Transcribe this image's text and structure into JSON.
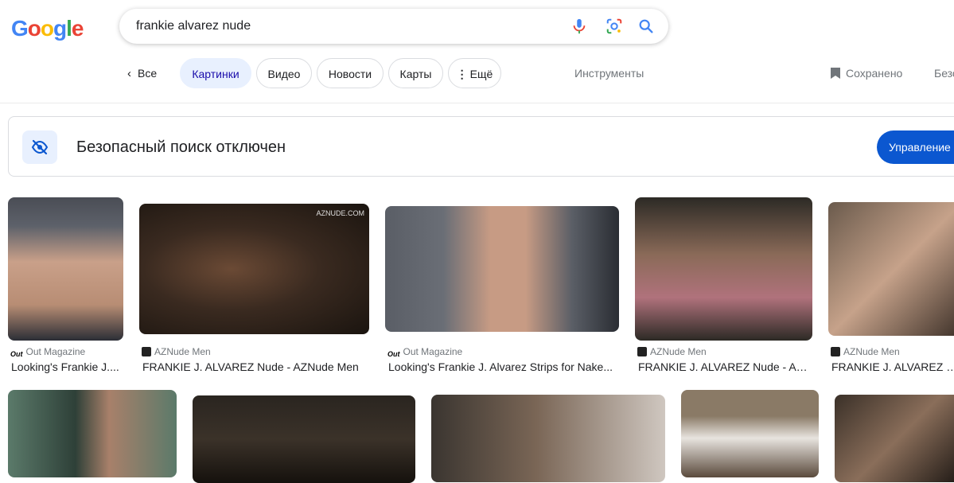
{
  "logo": "Google",
  "search": {
    "query": "frankie alvarez nude"
  },
  "tabs": {
    "back_label": "Все",
    "items": [
      "Картинки",
      "Видео",
      "Новости",
      "Карты",
      "Ещё"
    ],
    "tools": "Инструменты",
    "saved": "Сохранено",
    "cut_label": "Безо"
  },
  "safesearch": {
    "message": "Безопасный поиск отключен",
    "button": "Управление"
  },
  "results_row1": [
    {
      "source": "Out Magazine",
      "title": "Looking's Frankie J....",
      "colors": [
        "#4a4d55",
        "#c9a089",
        "#2b2e36"
      ]
    },
    {
      "source": "AZNude Men",
      "title": "FRANKIE J. ALVAREZ Nude - AZNude Men",
      "watermark": "AZNUDE.COM",
      "colors": [
        "#3a2a20",
        "#6b4a35",
        "#1a140f"
      ]
    },
    {
      "source": "Out Magazine",
      "title": "Looking's Frankie J. Alvarez Strips for Nake...",
      "colors": [
        "#5a5e66",
        "#c79b84",
        "#2a2d33"
      ]
    },
    {
      "source": "AZNude Men",
      "title": "FRANKIE J. ALVAREZ Nude - AZ...",
      "colors": [
        "#2c2a25",
        "#8a6a58",
        "#b0727c"
      ]
    },
    {
      "source": "AZNude Men",
      "title": "FRANKIE J. ALVAREZ Nu",
      "colors": [
        "#6a5a4c",
        "#c6a28a",
        "#3c3028"
      ]
    }
  ],
  "results_row2": [
    {
      "colors": [
        "#5b7a6a",
        "#a8806a",
        "#2e4038"
      ]
    },
    {
      "colors": [
        "#2a2520",
        "#3b3229",
        "#15110d"
      ]
    },
    {
      "colors": [
        "#3a3530",
        "#7a6656",
        "#cfc7c0"
      ]
    },
    {
      "colors": [
        "#8a7a66",
        "#e8e4df",
        "#5a4a3c"
      ]
    },
    {
      "colors": [
        "#3a3028",
        "#8a6e5a",
        "#1e1814"
      ]
    }
  ],
  "colors": {
    "accent": "#1a0dab",
    "button_blue": "#0b57d0",
    "chip_active": "#e8f0fe"
  }
}
